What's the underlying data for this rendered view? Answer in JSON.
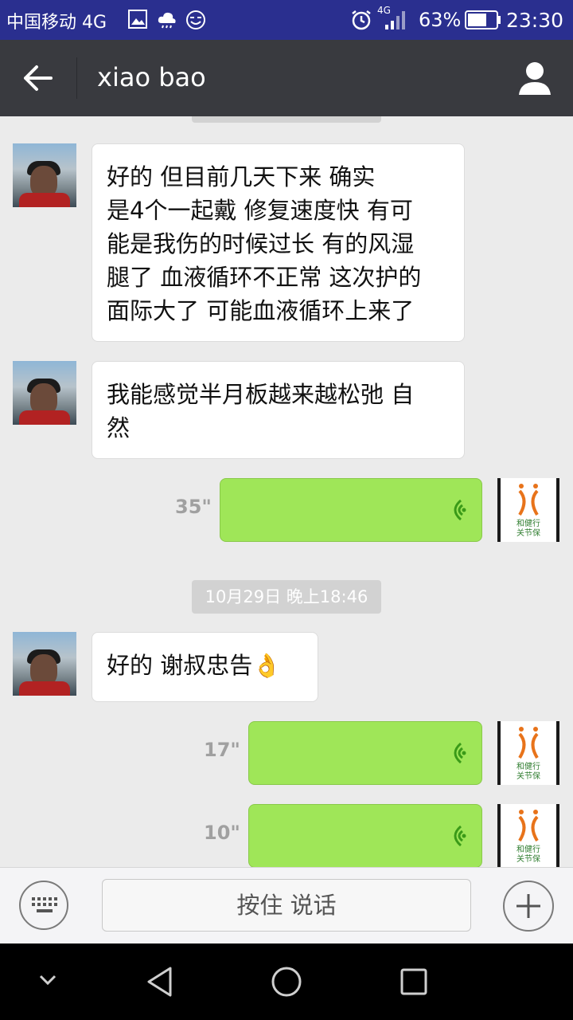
{
  "status_bar": {
    "carrier": "中国移动 4G",
    "network": "4G",
    "battery": "63%",
    "time": "23:30"
  },
  "header": {
    "title": "xiao bao",
    "back_icon": "back-arrow-icon",
    "profile_icon": "person-icon"
  },
  "messages": [
    {
      "type": "text",
      "side": "left",
      "text": "好的 但目前几天下来 确实\n是4个一起戴 修复速度快 有可\n能是我伤的时候过长 有的风湿\n腿了 血液循环不正常 这次护的\n面际大了 可能血液循环上来了"
    },
    {
      "type": "text",
      "side": "left",
      "text": "我能感觉半月板越来越松弛 自\n然"
    },
    {
      "type": "voice",
      "side": "right",
      "duration": "35\""
    },
    {
      "type": "timestamp",
      "text": "10月29日 晚上18:46"
    },
    {
      "type": "text",
      "side": "left",
      "text": "好的  谢叔忠告👌"
    },
    {
      "type": "voice",
      "side": "right",
      "duration": "17\""
    },
    {
      "type": "voice",
      "side": "right",
      "duration": "10\""
    }
  ],
  "my_avatar": {
    "tagline": "和健行\n关节保"
  },
  "input_bar": {
    "hold_to_talk": "按住 说话",
    "keyboard_icon": "keyboard-icon",
    "plus_icon": "plus-icon"
  },
  "colors": {
    "status_bar": "#2a2f8f",
    "title_bar": "#393a3f",
    "chat_bg": "#ebebeb",
    "voice_bubble": "#9fe658",
    "logo_orange": "#e8731a"
  }
}
